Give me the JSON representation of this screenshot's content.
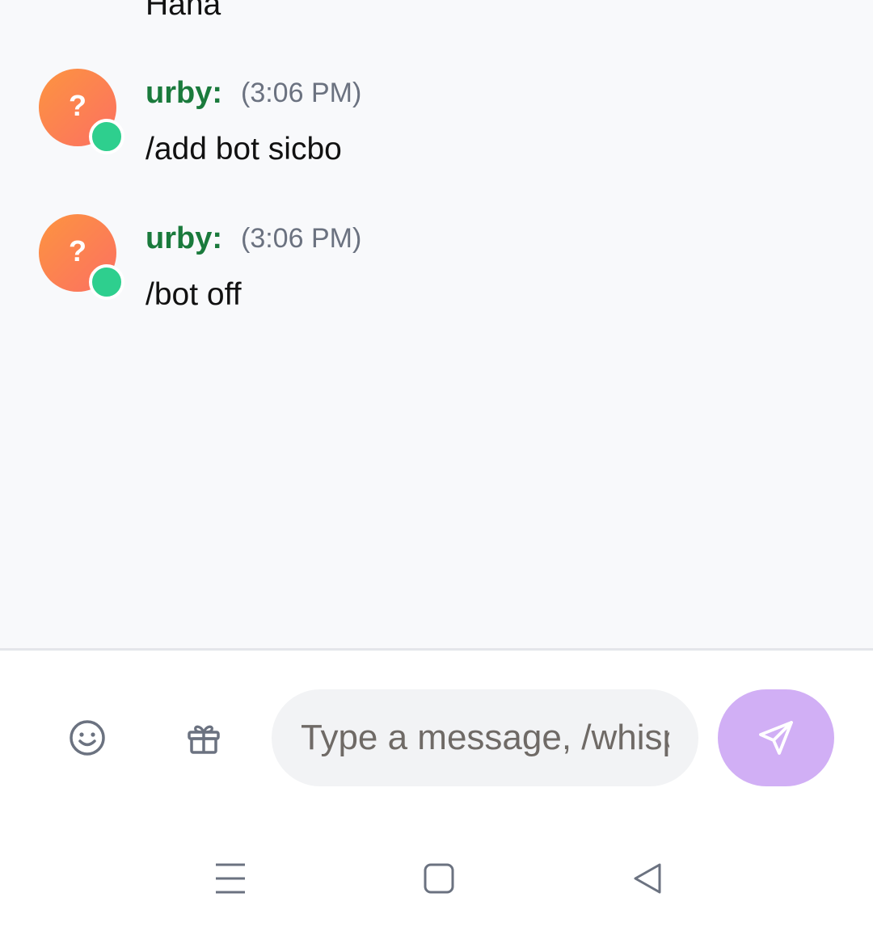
{
  "messages": [
    {
      "avatar_glyph": "?",
      "author": "",
      "time": "",
      "text": "Hana"
    },
    {
      "avatar_glyph": "?",
      "author": "urby:",
      "time": "(3:06 PM)",
      "text": "/add bot sicbo"
    },
    {
      "avatar_glyph": "?",
      "author": "urby:",
      "time": "(3:06 PM)",
      "text": "/bot off"
    }
  ],
  "composer": {
    "placeholder": "Type a message, /whisper...",
    "emoji_icon": "smile-icon",
    "gift_icon": "gift-icon",
    "send_icon": "send-icon"
  },
  "navbar": {
    "menu_icon": "menu-icon",
    "home_icon": "square-home-icon",
    "back_icon": "triangle-back-icon"
  },
  "colors": {
    "author": "#1a7a3c",
    "online": "#2ecf8e",
    "send_button": "#d1aff5",
    "avatar_gradient_start": "#fd9440",
    "avatar_gradient_end": "#fb7062"
  }
}
